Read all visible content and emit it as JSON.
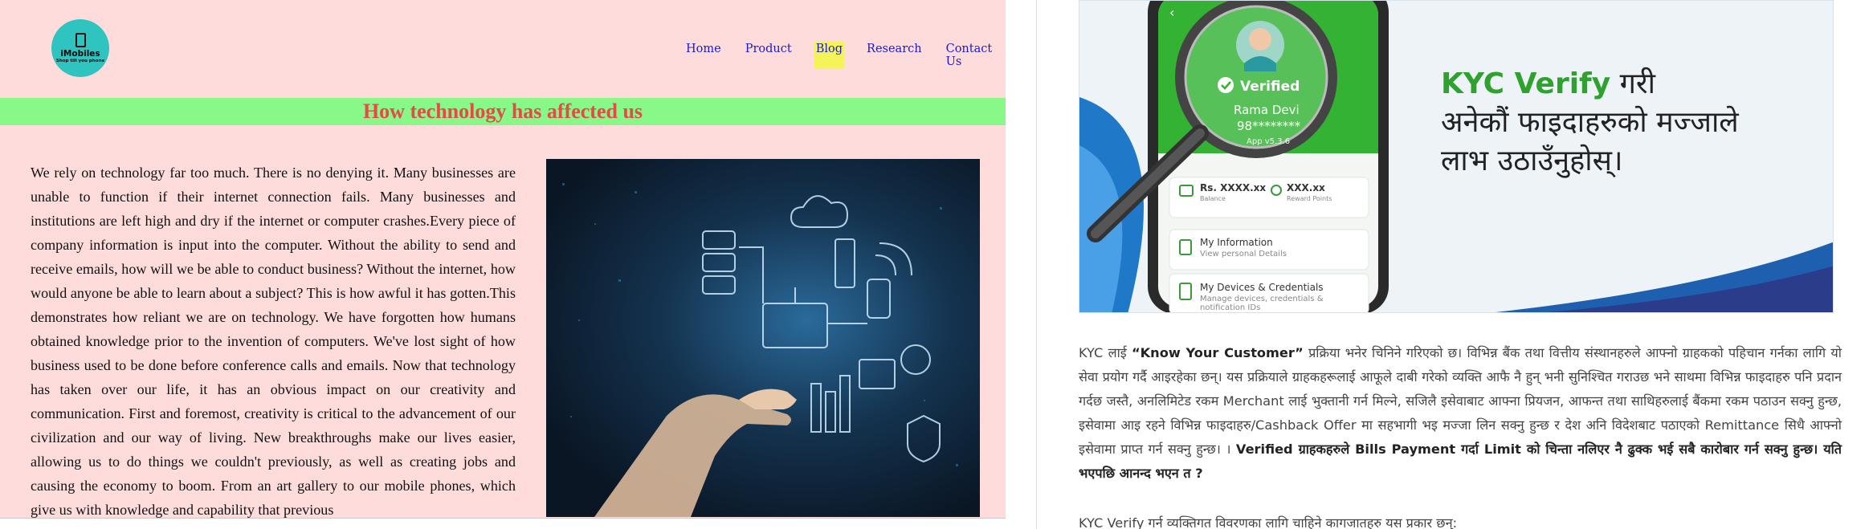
{
  "left_site": {
    "logo": {
      "brand": "iMobiles",
      "tagline": "Shop till you phone"
    },
    "nav": [
      "Home",
      "Product",
      "Blog",
      "Research",
      "Contact Us"
    ],
    "active_nav": "Blog",
    "title": "How technology has affected us",
    "article": "We rely on technology far too much. There is no denying it. Many businesses are unable to function if their internet connection fails. Many businesses and institutions are left high and dry if the internet or computer crashes.Every piece of company information is input into the computer. Without the ability to send and receive emails, how will we be able to conduct business? Without the internet, how would anyone be able to learn about a subject? This is how awful it has gotten.This demonstrates how reliant we are on technology. We have forgotten how humans obtained knowledge prior to the invention of computers. We've lost sight of how business used to be done before conference calls and emails. Now that technology has taken over our life, it has an obvious impact on our creativity and communication. First and foremost, creativity is critical to the advancement of our civilization and our way of living. New breakthroughs make our lives easier, allowing us to do things we couldn't previously, as well as creating jobs and causing the economy to boom. From an art gallery to our mobile phones, which give us with knowledge and capability that previous"
  },
  "right_site": {
    "banner": {
      "heading_green": "KYC Verify",
      "heading_rest_1": " गरी",
      "heading_line_2": "अनेकौं फाइदाहरुको मज्जाले",
      "heading_line_3": "लाभ उठाउँनुहोस्।",
      "verified_label": "Verified",
      "user_name": "Rama Devi",
      "user_phone": "98********",
      "app_version": "App v5.3.6",
      "balance_value": "Rs. XXXX.xx",
      "balance_label": "Balance",
      "reward_value": "XXX.xx",
      "reward_label": "Reward Points",
      "menu_1_title": "My Information",
      "menu_1_sub": "View personal Details",
      "menu_2_title": "My Devices & Credentials",
      "menu_2_sub": "Manage devices, credentials & notification IDs"
    },
    "para_intro": "KYC लाई ",
    "para_bold": "“Know Your Customer”",
    "para_rest": " प्रक्रिया भनेर चिनिने गरिएको छ। विभिन्न बैंक तथा वित्तीय संस्थानहरुले आफ्नो ग्राहकको पहिचान गर्नका लागि यो सेवा प्रयोग गर्दै आइरहेका छन्। यस प्रक्रियाले ग्राहकहरूलाई आफूले दाबी गरेको व्यक्ति आफै नै हुन् भनी सुनिश्चित गराउछ भने साथमा विभिन्न फाइदाहरु पनि प्रदान गर्दछ जस्तै, अनलिमिटेड रकम Merchant लाई भुक्तानी गर्न मिल्ने, सजिलै इसेवाबाट आफ्ना प्रियजन, आफन्त तथा साथिहरुलाई बैंकमा रकम पठाउन सक्नु हुन्छ, इसेवामा आइ रहने विभिन्न फाइदाहरु/Cashback Offer मा सहभागी भइ मज्जा लिन सक्नु हुन्छ र देश अनि विदेशबाट पठाएको Remittance सिधै आफ्नो इसेवामा प्राप्त गर्न सक्नु हुन्छ। । ",
    "para_bold_end": "Verified ग्राहकहरुले Bills Payment गर्दा Limit को चिन्ता नलिएर नै ढुक्क भई सबै कारोबार गर्न सक्नु हुन्छ। यति भएपछि आनन्द भएन त ?",
    "sub_text": "KYC Verify गर्न व्यक्तिगत विवरणका लागि चाहिने कागजातहरु यस प्रकार छन्:"
  },
  "colors": {
    "left_bg": "#ffdcdc",
    "title_bar": "#88f888",
    "title_text": "#e84848",
    "nav_link": "#1a1acc",
    "nav_highlight": "#f4f45a",
    "kyc_green": "#2ea12e",
    "logo_teal": "#2fc4c0"
  },
  "icons": [
    "mobile-phone-icon",
    "magnifier-icon",
    "verified-check-icon",
    "back-arrow-icon",
    "wallet-icon",
    "reward-icon",
    "info-icon",
    "devices-icon"
  ]
}
